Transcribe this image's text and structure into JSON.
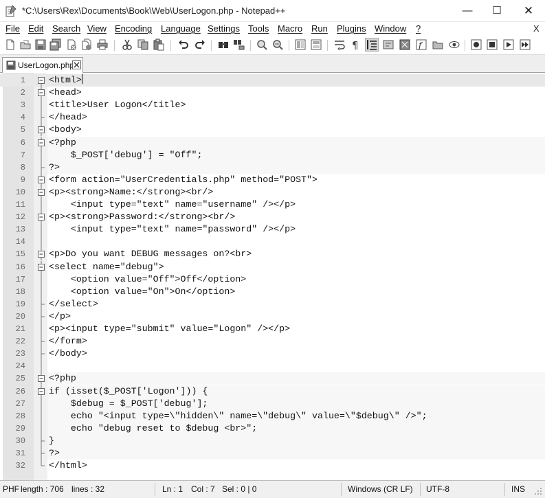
{
  "window": {
    "title": "*C:\\Users\\Rex\\Documents\\Book\\Web\\UserLogon.php - Notepad++",
    "minimize": "—",
    "maximize": "☐",
    "close": "✕"
  },
  "menu": {
    "items": [
      "File",
      "Edit",
      "Search",
      "View",
      "Encoding",
      "Language",
      "Settings",
      "Tools",
      "Macro",
      "Run",
      "Plugins",
      "Window",
      "?"
    ],
    "close": "X"
  },
  "toolbar": {
    "icons": [
      "new-file-icon",
      "open-file-icon",
      "save-icon",
      "save-all-icon",
      "close-icon",
      "close-all-icon",
      "print-icon",
      "cut-icon",
      "copy-icon",
      "paste-icon",
      "undo-icon",
      "redo-icon",
      "find-icon",
      "replace-icon",
      "zoom-in-icon",
      "zoom-out-icon",
      "sync-vertical-icon",
      "sync-horizontal-icon",
      "word-wrap-icon",
      "show-all-characters-icon",
      "indent-guide-icon",
      "udl-icon",
      "document-map-icon",
      "function-list-icon",
      "folder-workspace-icon",
      "monitoring-icon",
      "record-macro-icon",
      "stop-record-icon",
      "play-macro-icon",
      "run-macro-multiple-icon"
    ]
  },
  "tabs": [
    {
      "label": "UserLogon.php",
      "close": "✕"
    }
  ],
  "editor": {
    "lines": [
      "<html>",
      "<head>",
      "<title>User Logon</title>",
      "</head>",
      "<body>",
      "<?php",
      "    $_POST['debug'] = \"Off\";",
      "?>",
      "<form action=\"UserCredentials.php\" method=\"POST\">",
      "<p><strong>Name:</strong><br/>",
      "    <input type=\"text\" name=\"username\" /></p>",
      "<p><strong>Password:</strong><br/>",
      "    <input type=\"text\" name=\"password\" /></p>",
      "",
      "<p>Do you want DEBUG messages on?<br>",
      "<select name=\"debug\">",
      "    <option value=\"Off\">Off</option>",
      "    <option value=\"On\">On</option>",
      "</select>",
      "</p>",
      "<p><input type=\"submit\" value=\"Logon\" /></p>",
      "</form>",
      "</body>",
      "",
      "<?php",
      "if (isset($_POST['Logon'])) {",
      "    $debug = $_POST['debug'];",
      "    echo \"<input type=\\\"hidden\\\" name=\\\"debug\\\" value=\\\"$debug\\\" />\";",
      "    echo \"debug reset to $debug <br>\";",
      "}",
      "?>",
      "</html>"
    ],
    "line_numbers": [
      "1",
      "2",
      "3",
      "4",
      "5",
      "6",
      "7",
      "8",
      "9",
      "10",
      "11",
      "12",
      "13",
      "14",
      "15",
      "16",
      "17",
      "18",
      "19",
      "20",
      "21",
      "22",
      "23",
      "24",
      "25",
      "26",
      "27",
      "28",
      "29",
      "30",
      "31",
      "32"
    ],
    "current_line": 1
  },
  "status": {
    "type": "PHF",
    "length": "length : 706",
    "lines": "lines : 32",
    "ln": "Ln : 1",
    "col": "Col : 7",
    "sel": "Sel : 0 | 0",
    "eol": "Windows (CR LF)",
    "encoding": "UTF-8",
    "mode": "INS"
  }
}
